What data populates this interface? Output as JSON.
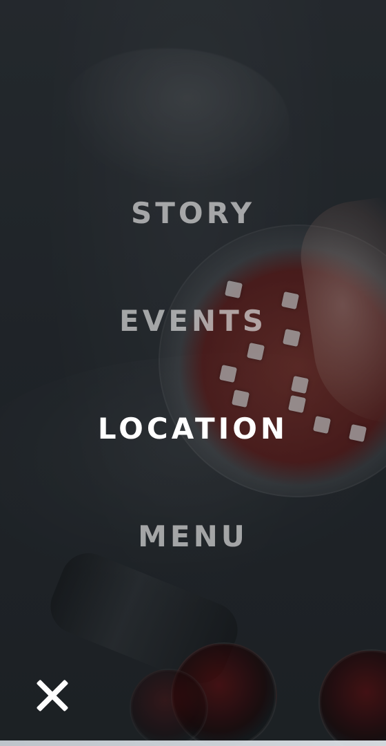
{
  "nav": {
    "items": [
      {
        "label": "STORY",
        "active": false
      },
      {
        "label": "EVENTS",
        "active": false
      },
      {
        "label": "LOCATION",
        "active": true
      },
      {
        "label": "MENU",
        "active": false
      }
    ]
  },
  "controls": {
    "close_icon": "close-icon"
  }
}
